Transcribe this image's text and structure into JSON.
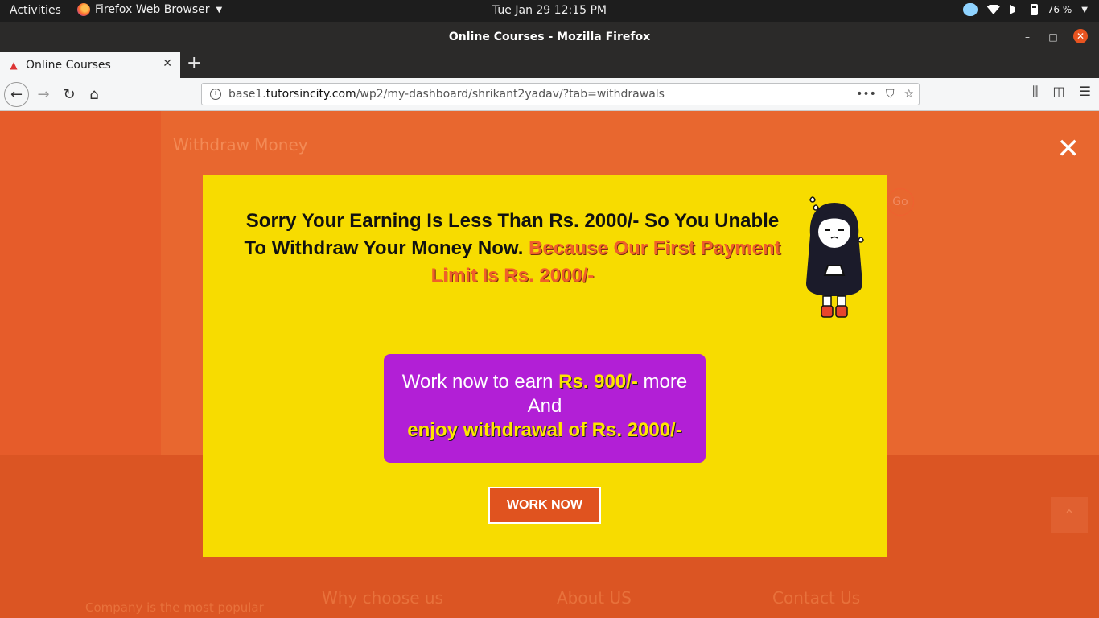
{
  "system": {
    "activities": "Activities",
    "app_name": "Firefox Web Browser",
    "clock": "Tue Jan 29  12:15 PM",
    "battery": "76 %"
  },
  "window": {
    "title": "Online Courses - Mozilla Firefox"
  },
  "tabs": [
    {
      "label": "Online Courses"
    }
  ],
  "navbar": {
    "url_prefix": "base1.",
    "url_domain": "tutorsincity.com",
    "url_path": "/wp2/my-dashboard/shrikant2yadav/?tab=withdrawals"
  },
  "page": {
    "title": "Withdraw Money",
    "go_label": "Go",
    "footer_intro": "Company is the most popular",
    "footer_cols": [
      "Why choose us",
      "About US",
      "Contact Us"
    ]
  },
  "modal": {
    "headline_part1": "Sorry Your Earning Is Less Than Rs. 2000/- So You Unable To Withdraw Your Money Now.",
    "headline_part2": "Because Our First Payment Limit Is Rs. 2000/-",
    "offer_prefix": "Work now to earn",
    "offer_amount": "Rs. 900/-",
    "offer_suffix": "more",
    "offer_and": "And",
    "offer_enjoy": "enjoy withdrawal of Rs. 2000/-",
    "button_label": "WORK NOW"
  },
  "colors": {
    "modal_bg": "#f7dc00",
    "offer_bg": "#b21fd6",
    "accent": "#e0531f",
    "highlight": "#ffe500"
  }
}
